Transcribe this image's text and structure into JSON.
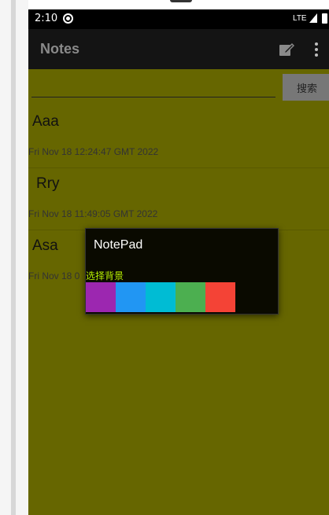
{
  "status_bar": {
    "time": "2:10",
    "network": "LTE"
  },
  "app_bar": {
    "title": "Notes",
    "actions": [
      "edit-icon",
      "more-vert-icon"
    ]
  },
  "search": {
    "value": "",
    "placeholder": "",
    "button_label": "搜索"
  },
  "notes": [
    {
      "title": "Aaa",
      "time": "Fri Nov 18 12:24:47 GMT 2022"
    },
    {
      "title": "Rry",
      "time": "Fri Nov 18 11:49:05 GMT 2022"
    },
    {
      "title": "Asa",
      "time": "Fri Nov 18 0"
    }
  ],
  "dialog": {
    "title": "NotePad",
    "label": "选择背景",
    "colors": [
      "#9C27B0",
      "#2196F3",
      "#00BCD4",
      "#4CAF50",
      "#F44336"
    ]
  },
  "theme": {
    "background": "#666600",
    "app_bar": "#141414",
    "status_bar": "#000000"
  }
}
